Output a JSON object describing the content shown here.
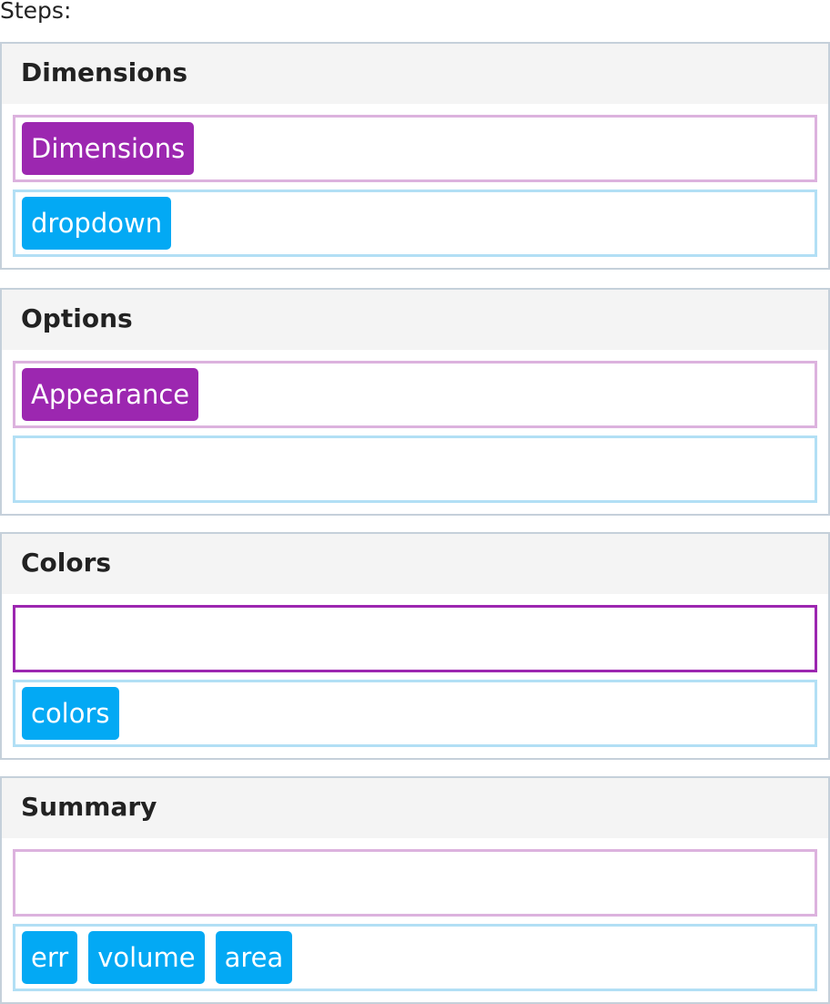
{
  "steps_label": "Steps:",
  "colors": {
    "purple_chip": "#9c27b0",
    "blue_chip": "#03a9f4",
    "purple_zone_border": "#dcb2de",
    "blue_zone_border": "#b2dff5",
    "step_border": "#c5d0da",
    "header_bg": "#f4f4f4"
  },
  "steps": [
    {
      "title": "Dimensions",
      "purple_items": [
        "Dimensions"
      ],
      "blue_items": [
        "dropdown"
      ]
    },
    {
      "title": "Options",
      "purple_items": [
        "Appearance"
      ],
      "blue_items": []
    },
    {
      "title": "Colors",
      "purple_items": [],
      "blue_items": [
        "colors"
      ]
    },
    {
      "title": "Summary",
      "purple_items": [],
      "blue_items": [
        "err",
        "volume",
        "area"
      ]
    }
  ]
}
